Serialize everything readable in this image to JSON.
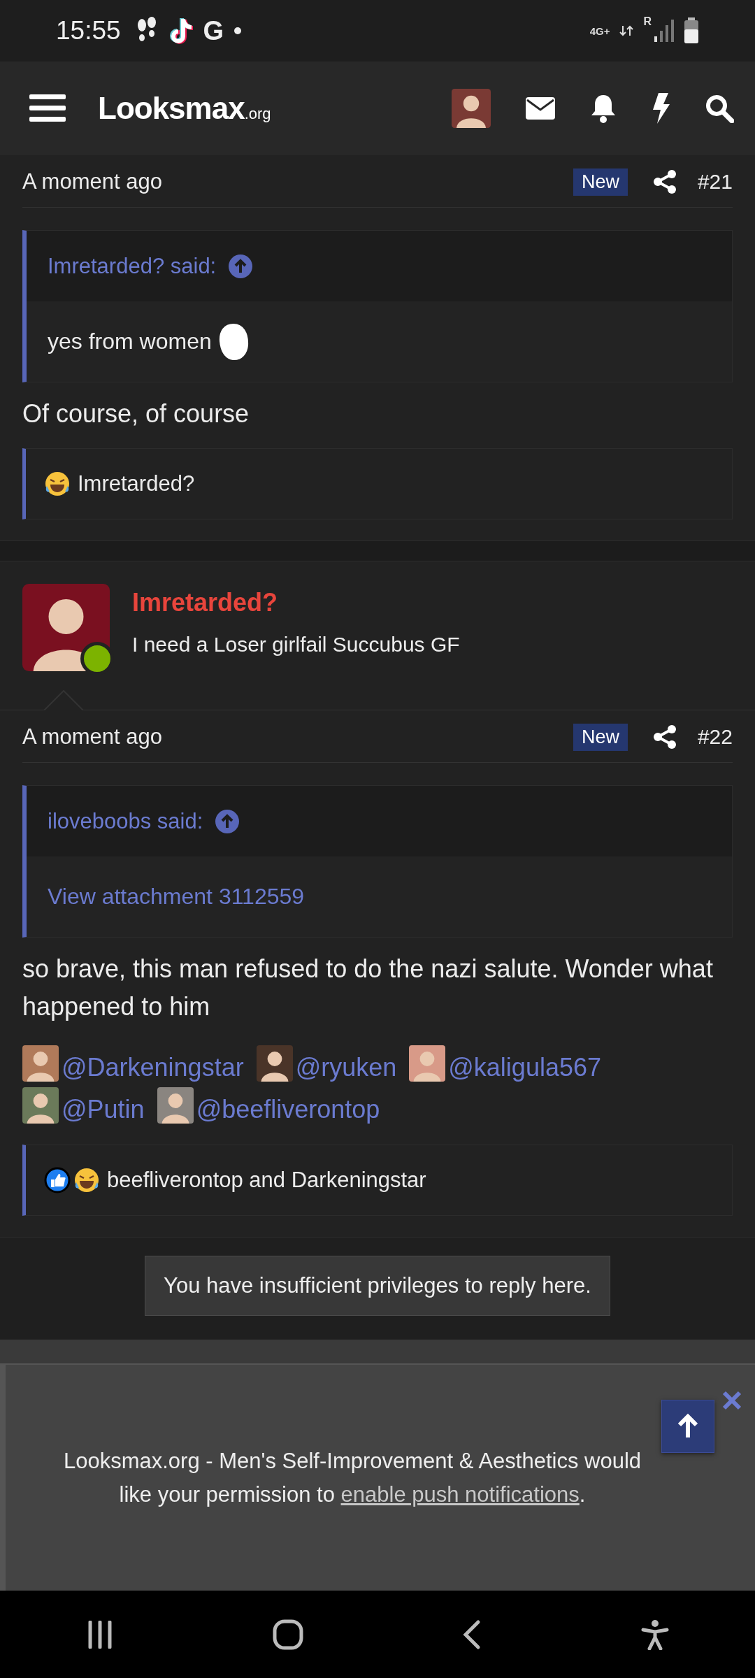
{
  "status_bar": {
    "time": "15:55",
    "app_letter": "G",
    "network": "4G+",
    "roaming": "R"
  },
  "header": {
    "logo": "Looksmax",
    "logo_suffix": ".org"
  },
  "posts": [
    {
      "time": "A moment ago",
      "badge": "New",
      "number": "#21",
      "quote": {
        "author": "Imretarded? said:",
        "kind": "text",
        "text": "yes from women"
      },
      "body": [
        "Of course, of course"
      ],
      "reactions": {
        "icons": [
          {
            "kind": "laugh"
          }
        ],
        "text": "Imretarded?"
      }
    },
    {
      "author": {
        "name": "Imretarded?",
        "title": "I need a Loser girlfail Succubus GF",
        "online": true
      },
      "time": "A moment ago",
      "badge": "New",
      "number": "#22",
      "quote": {
        "author": "iloveboobs said:",
        "kind": "link",
        "text": "View attachment 3112559"
      },
      "body": [
        "so brave, this man refused to do the nazi salute. Wonder what happened to him"
      ],
      "mentions": [
        {
          "name": "@Darkeningstar",
          "color": "#b07a5a"
        },
        {
          "name": "@ryuken",
          "color": "#4a3428"
        },
        {
          "name": "@kaligula567",
          "color": "#d89a88"
        },
        {
          "name": "@Putin",
          "color": "#6b7a5a"
        },
        {
          "name": "@beefliverontop",
          "color": "#8a8580"
        }
      ],
      "reactions": {
        "icons": [
          {
            "kind": "like"
          },
          {
            "kind": "laugh"
          }
        ],
        "text": "beefliverontop and Darkeningstar"
      }
    }
  ],
  "reply_notice": "You have insufficient privileges to reply here.",
  "push_banner": {
    "text": "Looksmax.org - Men's Self-Improvement & Aesthetics would like your permission to ",
    "link": "enable push notifications",
    "end": "."
  }
}
